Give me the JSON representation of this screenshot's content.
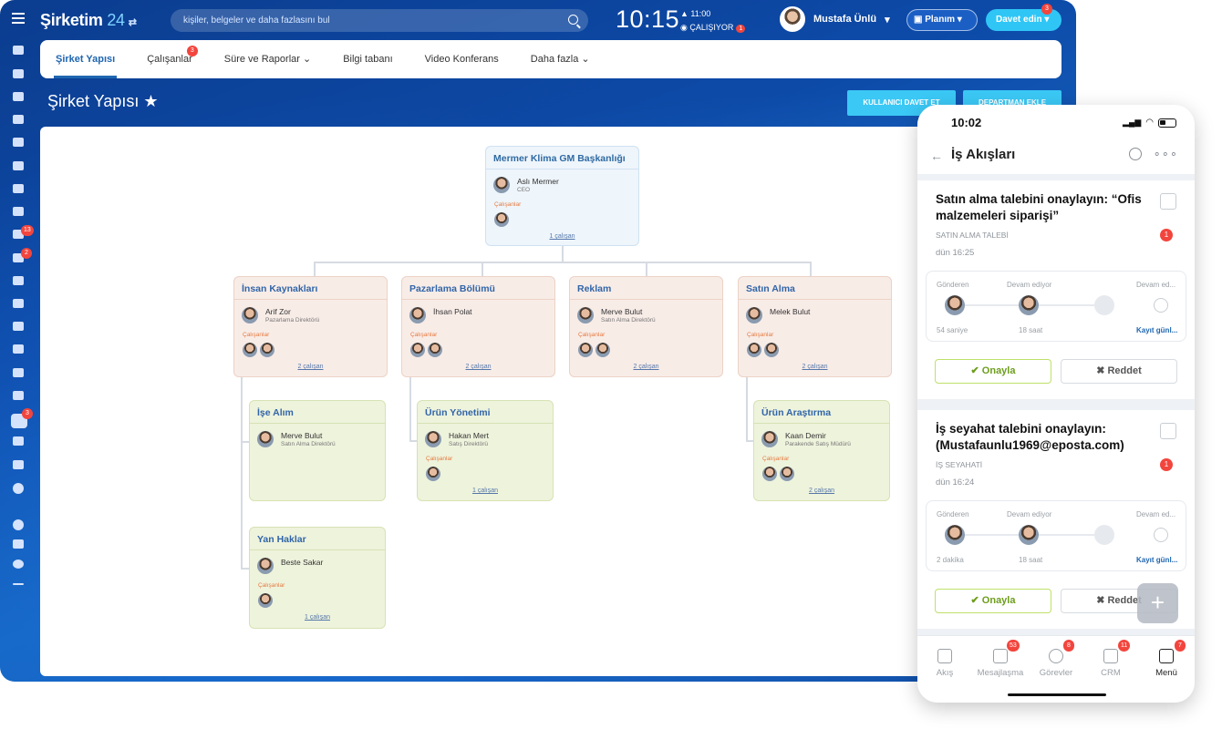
{
  "topbar": {
    "logo_text": "Şirketim",
    "logo_num": "24",
    "search_placeholder": "kişiler, belgeler ve daha fazlasını bul",
    "clock": "10:15",
    "alarm": "▲ 11:00",
    "status": "ÇALIŞIYOR",
    "status_badge": "1",
    "user_name": "Mustafa Ünlü",
    "planim": "Planım",
    "invite": "Davet edin",
    "invite_badge": "3"
  },
  "sidebar": {
    "badges": [
      "13",
      "2",
      "3"
    ]
  },
  "tabs": [
    {
      "label": "Şirket Yapısı"
    },
    {
      "label": "Çalışanlar",
      "badge": "3"
    },
    {
      "label": "Süre ve Raporlar ⌄"
    },
    {
      "label": "Bilgi tabanı"
    },
    {
      "label": "Video Konferans"
    },
    {
      "label": "Daha fazla ⌄"
    }
  ],
  "page": {
    "title": "Şirket Yapısı ★",
    "btn_invite": "KULLANICI DAVET ET",
    "btn_dept": "DEPARTMAN EKLE"
  },
  "org": {
    "root": {
      "title": "Mermer Klima GM Başkanlığı",
      "head": "Aslı Mermer",
      "pos": "CEO",
      "emp_label": "Çalışanlar",
      "count": "1 çalışan"
    },
    "hr": {
      "title": "İnsan Kaynakları",
      "head": "Arif Zor",
      "pos": "Pazarlama Direktörü",
      "emp_label": "Çalışanlar",
      "count": "2 çalışan"
    },
    "mkt": {
      "title": "Pazarlama Bölümü",
      "head": "İhsan Polat",
      "pos": "",
      "emp_label": "Çalışanlar",
      "count": "2 çalışan"
    },
    "ads": {
      "title": "Reklam",
      "head": "Merve Bulut",
      "pos": "Satın Alma Direktörü",
      "emp_label": "Çalışanlar",
      "count": "2 çalışan"
    },
    "buy": {
      "title": "Satın Alma",
      "head": "Melek Bulut",
      "pos": "",
      "emp_label": "Çalışanlar",
      "count": "2 çalışan"
    },
    "hire": {
      "title": "İşe Alım",
      "head": "Merve Bulut",
      "pos": "Satın Alma Direktörü"
    },
    "prod": {
      "title": "Ürün Yönetimi",
      "head": "Hakan Mert",
      "pos": "Satış Direktörü",
      "emp_label": "Çalışanlar",
      "count": "1 çalışan"
    },
    "research": {
      "title": "Ürün Araştırma",
      "head": "Kaan Demir",
      "pos": "Parakende Satış Müdürü",
      "emp_label": "Çalışanlar",
      "count": "2 çalışan"
    },
    "benefits": {
      "title": "Yan Haklar",
      "head": "Beste Sakar",
      "pos": "",
      "emp_label": "Çalışanlar",
      "count": "1 çalışan"
    }
  },
  "phone": {
    "time": "10:02",
    "title": "İş Akışları",
    "back": "←",
    "more": "∘∘∘",
    "tasks": [
      {
        "title": "Satın alma talebini onaylayın: “Ofis malzemeleri siparişi”",
        "type": "SATIN ALMA TALEBİ",
        "date": "dün 16:25",
        "badge": "1",
        "sent_label": "Gönderen",
        "sent_time": "54 saniye",
        "prog_label": "Devam ediyor",
        "prog_time": "18 saat",
        "next_label": "Devam ed...",
        "next_link": "Kayıt günl...",
        "approve": "✔ Onayla",
        "reject": "✖ Reddet"
      },
      {
        "title": "İş seyahat talebini onaylayın: (Mustafaunlu1969@eposta.com)",
        "type": "İŞ SEYAHATİ",
        "date": "dün 16:24",
        "badge": "1",
        "sent_label": "Gönderen",
        "sent_time": "2 dakika",
        "prog_label": "Devam ediyor",
        "prog_time": "18 saat",
        "next_label": "Devam ed...",
        "next_link": "Kayıt günl...",
        "approve": "✔ Onayla",
        "reject": "✖ Reddet"
      }
    ],
    "plus": "+",
    "nav": [
      {
        "label": "Akış",
        "badge": ""
      },
      {
        "label": "Mesajlaşma",
        "badge": "53"
      },
      {
        "label": "Görevler",
        "badge": "8"
      },
      {
        "label": "CRM",
        "badge": "11"
      },
      {
        "label": "Menü",
        "badge": "7"
      }
    ]
  },
  "colors": {
    "accent": "#2fc6f6",
    "brand": "#0d4aa8",
    "badge": "#f2453d",
    "approve": "#6d9d1c"
  }
}
